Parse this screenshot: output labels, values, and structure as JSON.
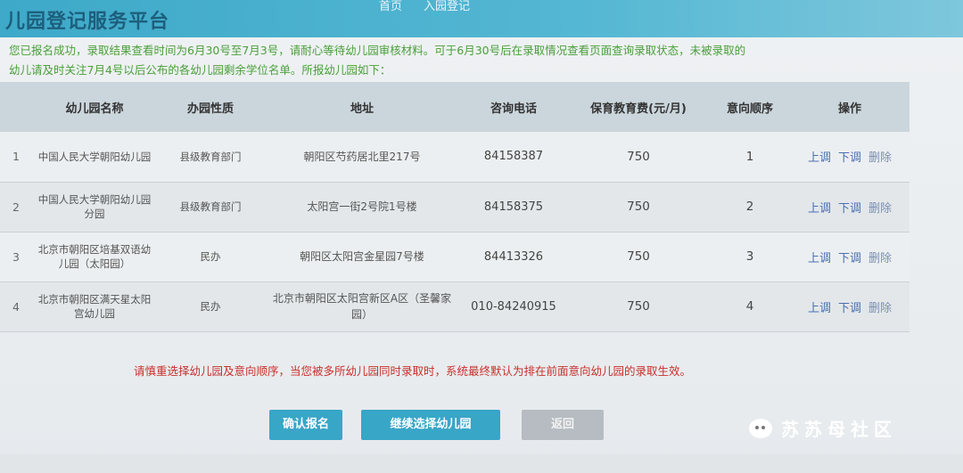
{
  "header": {
    "site_title": "儿园登记服务平台",
    "nav": [
      "首页",
      "入园登记"
    ]
  },
  "notice": {
    "line1": "您已报名成功，录取结果查看时间为6月30号至7月3号，请耐心等待幼儿园审核材料。可于6月30号后在录取情况查看页面查询录取状态，未被录取的",
    "line2": "幼儿请及时关注7月4号以后公布的各幼儿园剩余学位名单。所报幼儿园如下："
  },
  "table": {
    "headers": [
      "",
      "幼儿园名称",
      "办园性质",
      "地址",
      "咨询电话",
      "保育教育费(元/月)",
      "意向顺序",
      "操作"
    ],
    "rows": [
      {
        "idx": "1",
        "name": "中国人民大学朝阳幼儿园",
        "type": "县级教育部门",
        "address": "朝阳区芍药居北里217号",
        "phone": "84158387",
        "fee": "750",
        "order": "1"
      },
      {
        "idx": "2",
        "name": "中国人民大学朝阳幼儿园分园",
        "type": "县级教育部门",
        "address": "太阳宫一街2号院1号楼",
        "phone": "84158375",
        "fee": "750",
        "order": "2"
      },
      {
        "idx": "3",
        "name": "北京市朝阳区培基双语幼儿园（太阳园）",
        "type": "民办",
        "address": "朝阳区太阳宫金星园7号楼",
        "phone": "84413326",
        "fee": "750",
        "order": "3"
      },
      {
        "idx": "4",
        "name": "北京市朝阳区满天星太阳宫幼儿园",
        "type": "民办",
        "address": "北京市朝阳区太阳宫新区A区（圣馨家园）",
        "phone": "010-84240915",
        "fee": "750",
        "order": "4"
      }
    ],
    "ops": {
      "up": "上调",
      "down": "下调",
      "del": "删除"
    }
  },
  "warning": "请慎重选择幼儿园及意向顺序，当您被多所幼儿园同时录取时，系统最终默认为排在前面意向幼儿园的录取生效。",
  "buttons": {
    "confirm": "确认报名",
    "continue": "继续选择幼儿园",
    "back": "返回"
  },
  "watermark": "苏苏母社区"
}
